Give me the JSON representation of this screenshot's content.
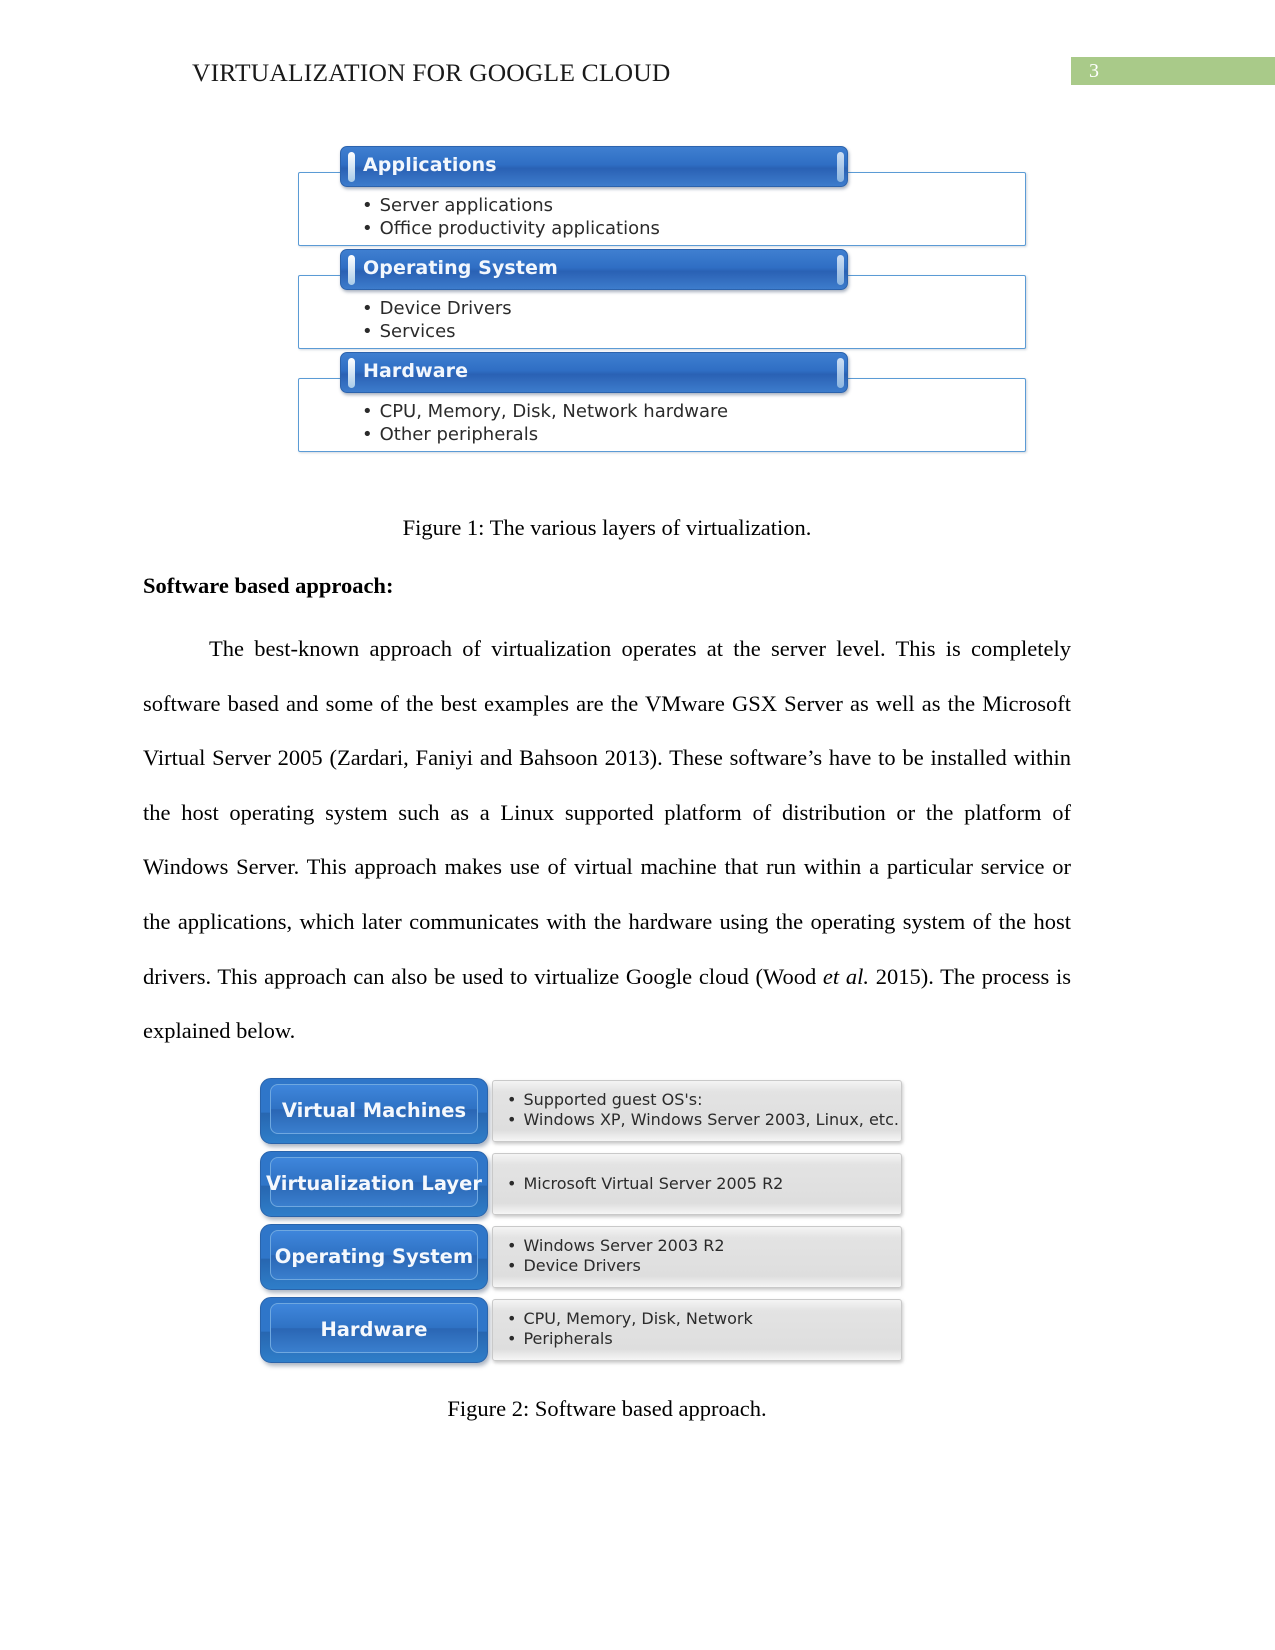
{
  "header": {
    "running_title": "VIRTUALIZATION FOR GOOGLE CLOUD",
    "page_number": "3",
    "page_number_bg": "#a9ca89"
  },
  "figure1": {
    "caption": "Figure 1: The various layers of virtualization.",
    "layers": [
      {
        "title": "Applications",
        "bullets": [
          "Server applications",
          "Office productivity applications"
        ]
      },
      {
        "title": "Operating System",
        "bullets": [
          "Device Drivers",
          "Services"
        ]
      },
      {
        "title": "Hardware",
        "bullets": [
          "CPU, Memory, Disk, Network hardware",
          "Other peripherals"
        ]
      }
    ]
  },
  "section": {
    "heading": "Software based approach:",
    "paragraph_part1": "The best-known approach of virtualization operates at the server level. This is completely software based and some of the best examples are the VMware GSX Server as well as the Microsoft Virtual Server 2005 (Zardari, Faniyi and Bahsoon 2013). These software’s have to be installed within the host operating system such as a Linux supported platform of distribution or the platform of Windows Server. This approach makes use of virtual machine that run within a particular service or the applications, which later communicates with the hardware using the operating system of the host drivers. This approach can also be used to virtualize Google cloud (Wood  ",
    "paragraph_italic": "et al.",
    "paragraph_part2": " 2015). The process is explained below."
  },
  "figure2": {
    "caption": "Figure 2: Software based approach.",
    "rows": [
      {
        "label": "Virtual Machines",
        "bullets": [
          "Supported guest OS's:",
          "Windows XP, Windows Server 2003, Linux, etc."
        ]
      },
      {
        "label": "Virtualization Layer",
        "bullets": [
          "Microsoft Virtual Server 2005 R2"
        ]
      },
      {
        "label": "Operating System",
        "bullets": [
          "Windows Server 2003 R2",
          "Device Drivers"
        ]
      },
      {
        "label": "Hardware",
        "bullets": [
          "CPU, Memory, Disk, Network",
          "Peripherals"
        ]
      }
    ]
  },
  "bullet_glyph": "•"
}
